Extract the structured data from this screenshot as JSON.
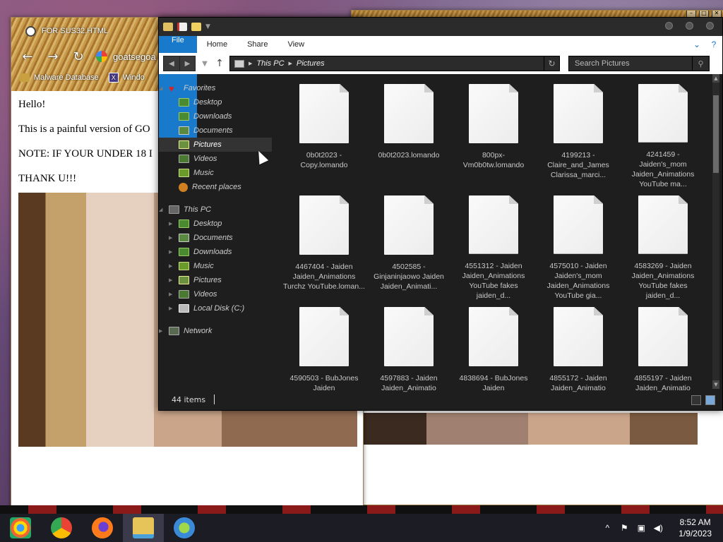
{
  "browser": {
    "tab_title": "FOR SUS32.HTML",
    "address": "goatsegoa",
    "bookmarks": [
      {
        "label": "Malware Database"
      },
      {
        "label": "Windo"
      }
    ],
    "page_lines": [
      "Hello!",
      "This is a painful version of GO",
      "NOTE: IF YOUR UNDER 18 I",
      "THANK U!!!"
    ]
  },
  "explorer": {
    "ribbon": {
      "file": "File",
      "home": "Home",
      "share": "Share",
      "view": "View"
    },
    "breadcrumb": [
      "This PC",
      "Pictures"
    ],
    "search_placeholder": "Search Pictures",
    "nav": {
      "favorites": "Favorites",
      "fav_items": [
        "Desktop",
        "Downloads",
        "Documents",
        "Pictures",
        "Videos",
        "Music",
        "Recent places"
      ],
      "this_pc": "This PC",
      "pc_items": [
        "Desktop",
        "Documents",
        "Downloads",
        "Music",
        "Pictures",
        "Videos",
        "Local Disk (C:)"
      ],
      "network": "Network"
    },
    "files": [
      "0b0t2023 - Copy.lomando",
      "0b0t2023.lomando",
      "800px-Vm0b0tw.lomando",
      "4199213 - Claire_and_James Clarissa_marci...",
      "4241459 - Jaiden's_mom Jaiden_Animations YouTube ma...",
      "4467404 - Jaiden Jaiden_Animations Turchz YouTube.loman...",
      "4502585 - Ginjaninjaowo Jaiden Jaiden_Animati...",
      "4551312 - Jaiden Jaiden_Animations YouTube fakes jaiden_d...",
      "4575010 - Jaiden Jaiden's_mom Jaiden_Animations YouTube gia...",
      "4583269 - Jaiden Jaiden_Animations YouTube fakes jaiden_d...",
      "4590503 - BubJones Jaiden",
      "4597883 - Jaiden Jaiden_Animatio",
      "4838694 - BubJones Jaiden",
      "4855172 - Jaiden Jaiden_Animatio",
      "4855197 - Jaiden Jaiden_Animatio"
    ],
    "status": "44 items"
  },
  "taskbar": {
    "time": "8:52 AM",
    "date": "1/9/2023"
  }
}
